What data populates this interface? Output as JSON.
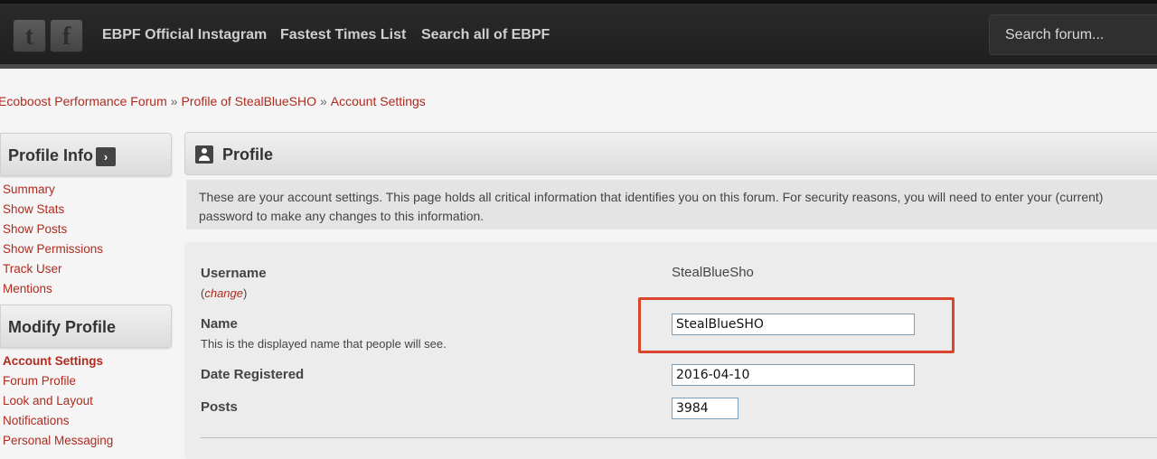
{
  "topbar": {
    "social": [
      {
        "name": "twitter-icon",
        "glyph": "t"
      },
      {
        "name": "facebook-icon",
        "glyph": "f"
      }
    ],
    "nav": [
      "EBPF Official Instagram",
      "Fastest Times List",
      "Search all of EBPF"
    ],
    "search_placeholder": "Search forum..."
  },
  "breadcrumb": [
    "Ecoboost Performance Forum",
    "Profile of StealBlueSHO",
    "Account Settings"
  ],
  "breadcrumb_sep": "»",
  "sidebar": {
    "profile_info": {
      "title": "Profile Info",
      "items": [
        "Summary",
        "Show Stats",
        "Show Posts",
        "Show Permissions",
        "Track User",
        "Mentions"
      ]
    },
    "modify_profile": {
      "title": "Modify Profile",
      "items": [
        "Account Settings",
        "Forum Profile",
        "Look and Layout",
        "Notifications",
        "Personal Messaging"
      ],
      "active": "Account Settings"
    },
    "arrow_glyph": "›"
  },
  "main": {
    "title": "Profile",
    "description": "These are your account settings. This page holds all critical information that identifies you on this forum. For security reasons, you will need to enter your (current) password to make any changes to this information.",
    "username": {
      "label": "Username",
      "value": "StealBlueSho",
      "change_open": "(",
      "change_link": "change",
      "change_close": ")"
    },
    "name": {
      "label": "Name",
      "hint": "This is the displayed name that people will see.",
      "value": "StealBlueSHO"
    },
    "date_registered": {
      "label": "Date Registered",
      "value": "2016-04-10"
    },
    "posts": {
      "label": "Posts",
      "value": "3984"
    }
  },
  "colors": {
    "link": "#b02a1e",
    "highlight": "#d9452d",
    "topbar": "#252525"
  }
}
